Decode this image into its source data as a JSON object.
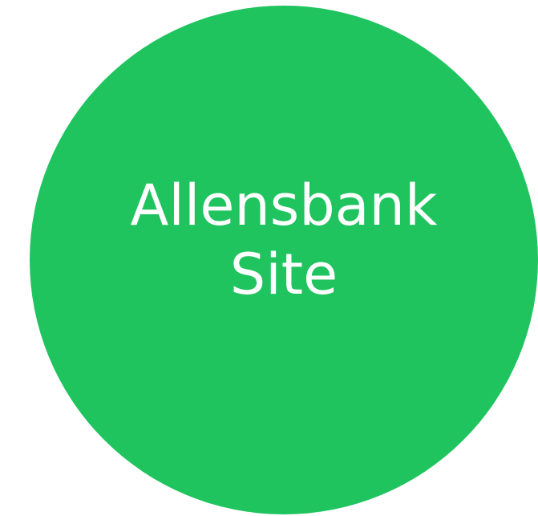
{
  "node": {
    "line1": "Allensbank",
    "line2": "Site"
  },
  "colors": {
    "fill": "#1FC45F",
    "text": "#FFFFFF"
  }
}
